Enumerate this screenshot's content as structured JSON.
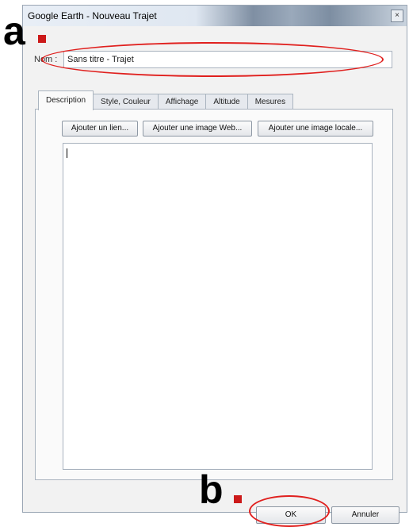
{
  "window": {
    "title": "Google Earth - Nouveau Trajet",
    "close_glyph": "×"
  },
  "name_field": {
    "label": "Nom :",
    "value": "Sans titre - Trajet"
  },
  "tabs": [
    {
      "label": "Description",
      "active": true
    },
    {
      "label": "Style, Couleur",
      "active": false
    },
    {
      "label": "Affichage",
      "active": false
    },
    {
      "label": "Altitude",
      "active": false
    },
    {
      "label": "Mesures",
      "active": false
    }
  ],
  "description_buttons": {
    "add_link": "Ajouter un lien...",
    "add_web_image": "Ajouter une image Web...",
    "add_local_image": "Ajouter une image locale..."
  },
  "footer": {
    "ok_label": "OK",
    "cancel_label": "Annuler"
  },
  "annotations": {
    "a_letter": "a",
    "b_letter": "b",
    "highlight_color": "#e0201e",
    "dot_color": "#cc1a1a"
  }
}
